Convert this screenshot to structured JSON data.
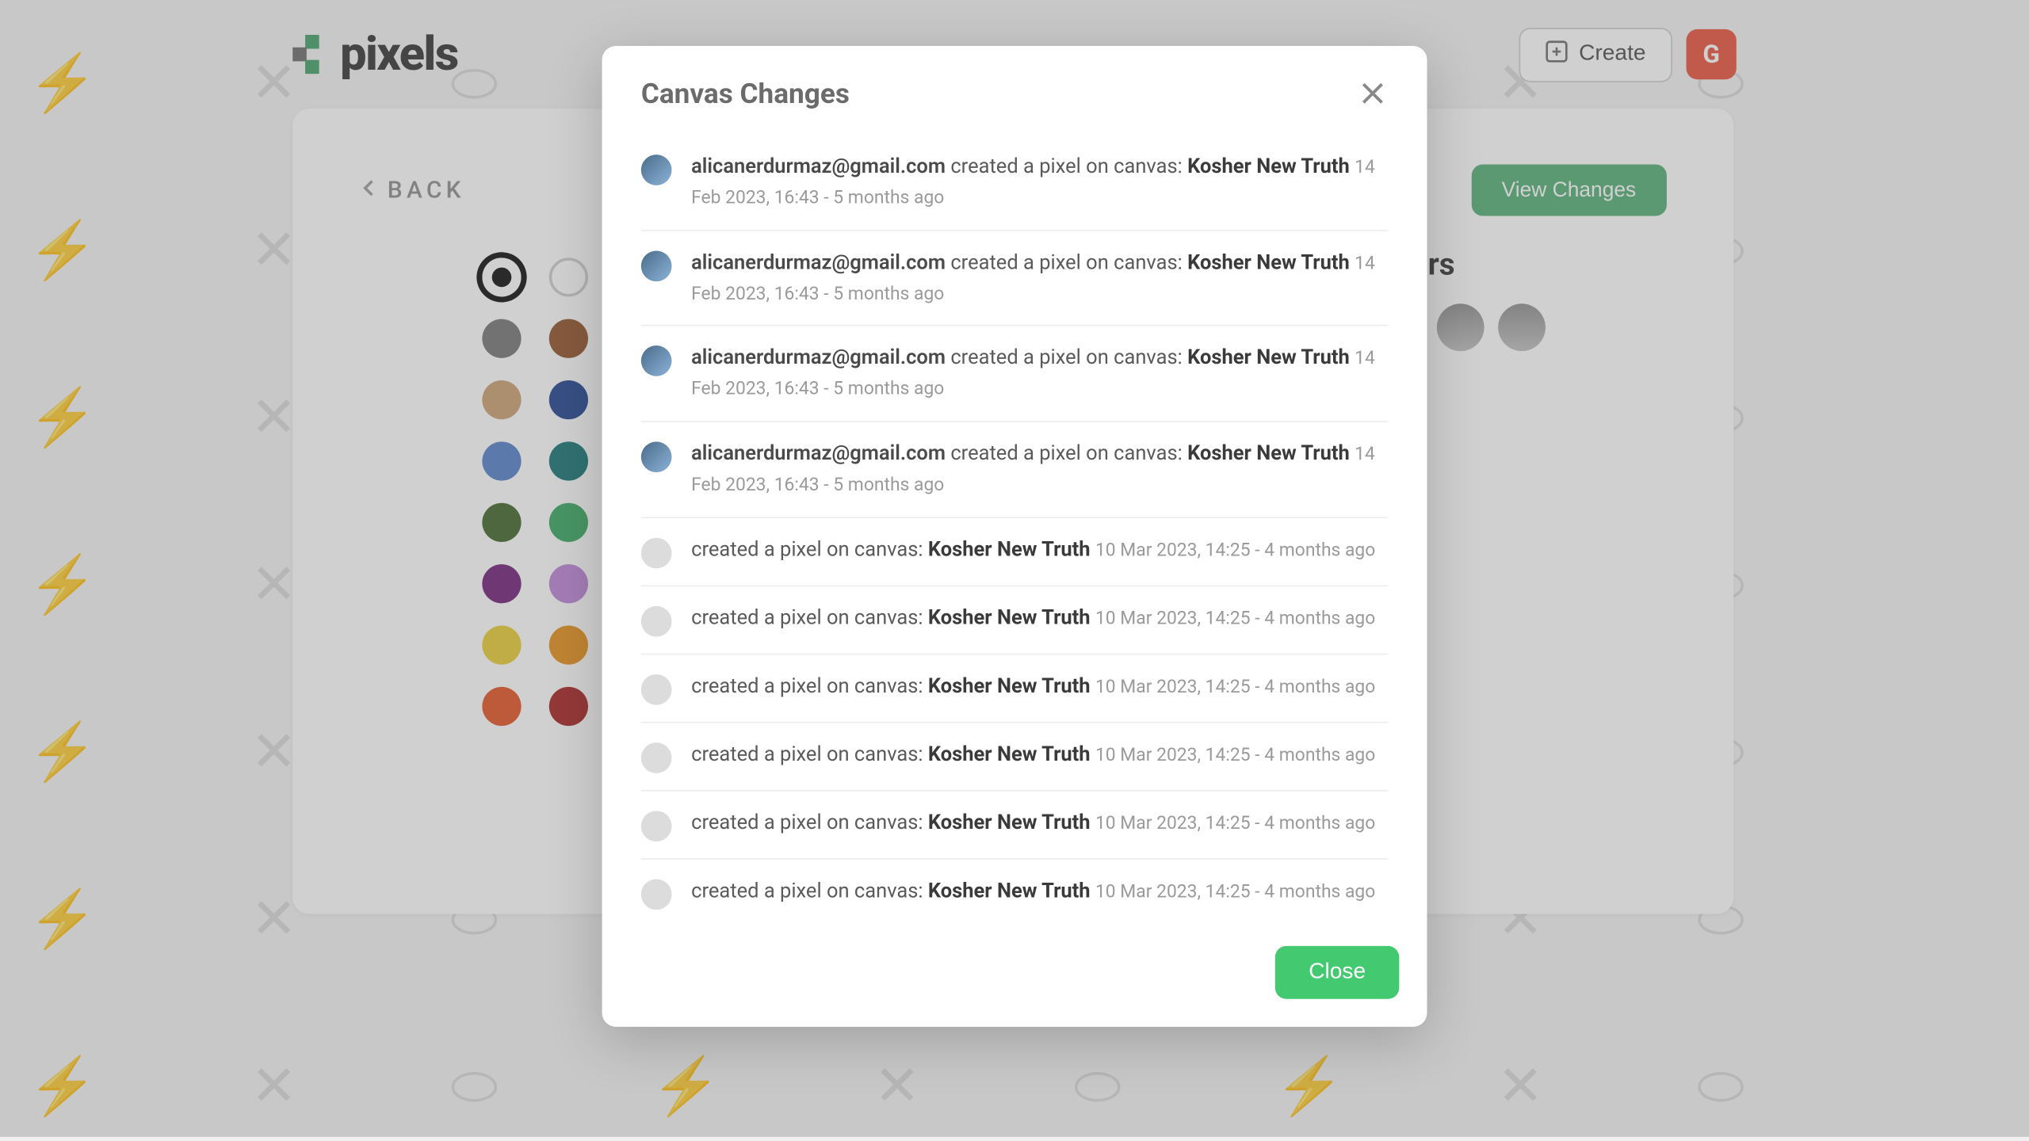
{
  "header": {
    "logo_text": "pixels",
    "create_label": "Create",
    "user_initial": "G"
  },
  "card": {
    "back_label": "BACK",
    "view_changes_label": "View Changes",
    "users_heading_suffix": "rs"
  },
  "palette": [
    {
      "color": "#000000",
      "selected": true
    },
    {
      "color": "#ffffff",
      "outline": true
    },
    {
      "color": "#6f6f6f"
    },
    {
      "color": "#8c4a1f"
    },
    {
      "color": "#c89b6b"
    },
    {
      "color": "#153a8a"
    },
    {
      "color": "#4c7bc7"
    },
    {
      "color": "#0b6e6e"
    },
    {
      "color": "#3a5f1f"
    },
    {
      "color": "#2fa35a"
    },
    {
      "color": "#6a1570"
    },
    {
      "color": "#bb7ed6"
    },
    {
      "color": "#e9c92a"
    },
    {
      "color": "#e58b0f"
    },
    {
      "color": "#e24a1a"
    },
    {
      "color": "#a31616"
    }
  ],
  "modal": {
    "title": "Canvas Changes",
    "close_label": "Close"
  },
  "action_text": " created a pixel on canvas: ",
  "action_text_anon": "created a pixel on canvas: ",
  "changes": [
    {
      "user": "alicanerdurmaz@gmail.com",
      "canvas": "Kosher New Truth",
      "ts": "14 Feb 2023, 16:43 - 5 months ago",
      "hasAvatar": true
    },
    {
      "user": "alicanerdurmaz@gmail.com",
      "canvas": "Kosher New Truth",
      "ts": "14 Feb 2023, 16:43 - 5 months ago",
      "hasAvatar": true
    },
    {
      "user": "alicanerdurmaz@gmail.com",
      "canvas": "Kosher New Truth",
      "ts": "14 Feb 2023, 16:43 - 5 months ago",
      "hasAvatar": true
    },
    {
      "user": "alicanerdurmaz@gmail.com",
      "canvas": "Kosher New Truth",
      "ts": "14 Feb 2023, 16:43 - 5 months ago",
      "hasAvatar": true
    },
    {
      "user": "",
      "canvas": "Kosher New Truth",
      "ts": "10 Mar 2023, 14:25 - 4 months ago",
      "hasAvatar": false
    },
    {
      "user": "",
      "canvas": "Kosher New Truth",
      "ts": "10 Mar 2023, 14:25 - 4 months ago",
      "hasAvatar": false
    },
    {
      "user": "",
      "canvas": "Kosher New Truth",
      "ts": "10 Mar 2023, 14:25 - 4 months ago",
      "hasAvatar": false
    },
    {
      "user": "",
      "canvas": "Kosher New Truth",
      "ts": "10 Mar 2023, 14:25 - 4 months ago",
      "hasAvatar": false
    },
    {
      "user": "",
      "canvas": "Kosher New Truth",
      "ts": "10 Mar 2023, 14:25 - 4 months ago",
      "hasAvatar": false
    },
    {
      "user": "",
      "canvas": "Kosher New Truth",
      "ts": "10 Mar 2023, 14:25 - 4 months ago",
      "hasAvatar": false
    }
  ]
}
